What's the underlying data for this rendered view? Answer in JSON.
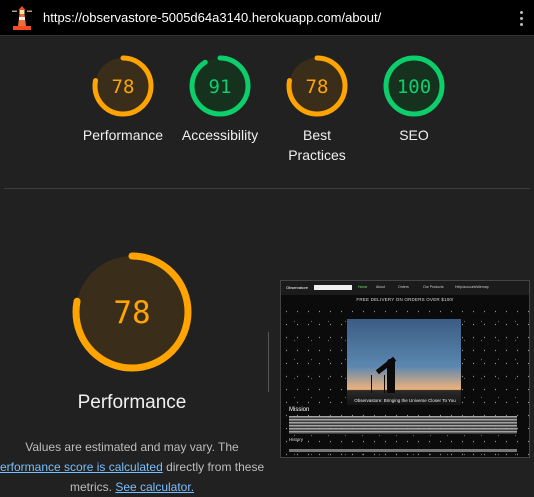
{
  "url_bar": {
    "url": "https://observastore-5005d64a3140.herokuapp.com/about/",
    "logo_icon": "lighthouse-icon",
    "menu_icon": "kebab-menu-icon"
  },
  "scores": [
    {
      "label": "Performance",
      "score": 78,
      "score_text": "78",
      "status": "average"
    },
    {
      "label": "Accessibility",
      "score": 91,
      "score_text": "91",
      "status": "pass"
    },
    {
      "label": "Best Practices",
      "score": 78,
      "score_text": "78",
      "status": "average"
    },
    {
      "label": "SEO",
      "score": 100,
      "score_text": "100",
      "status": "pass"
    }
  ],
  "colors": {
    "average": "#ffa400",
    "pass": "#0cce6b",
    "average_fill": "#3a2e1a",
    "pass_fill": "#17311f"
  },
  "performance_detail": {
    "score": 78,
    "score_text": "78",
    "title": "Performance",
    "note_prefix": "Values are estimated and may vary. The",
    "note_link": "erformance score is calculated",
    "note_middle": "directly from these",
    "note_end": "metrics.",
    "calculator_link": "See calculator."
  },
  "screenshot_preview": {
    "brand": "Observatore",
    "nav_links": [
      "Home",
      "About",
      "Orders",
      "Our Products",
      "Help/account/sitemap"
    ],
    "promo": "FREE DELIVERY ON ORDERS OVER $100!",
    "hero_caption": "Observastore: Bringing the Universe Closer To You",
    "mission_heading": "Mission",
    "history_heading": "History"
  }
}
